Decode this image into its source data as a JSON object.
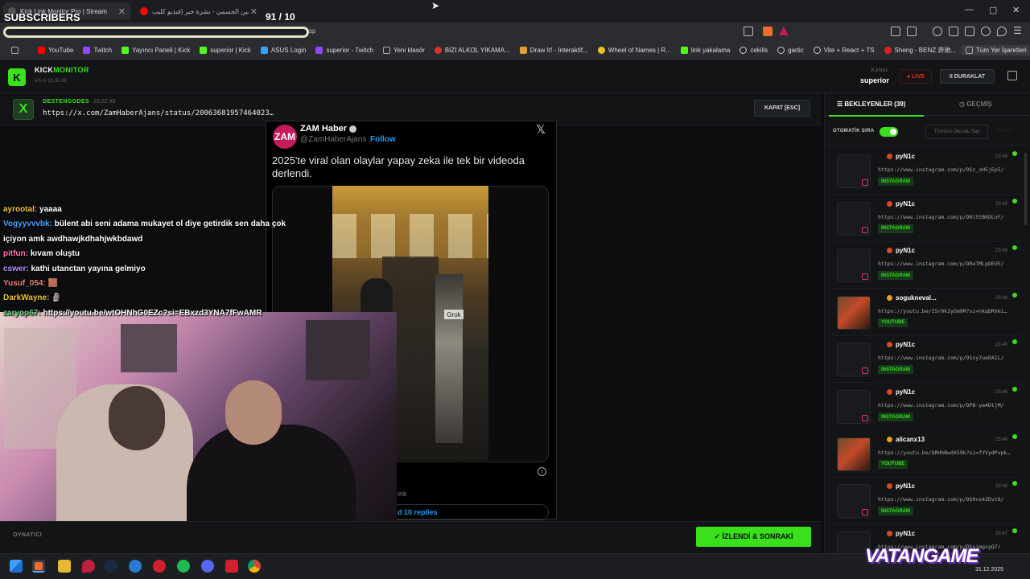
{
  "browser": {
    "tabs": [
      {
        "label": "Kick Link Monitor Pro | Stream",
        "active": true
      },
      {
        "label": "حسين الجسمي - بشرة خير (فيديو كليب...",
        "active": false
      }
    ],
    "overlay_subscribers": "SUBSCRIBERS",
    "overlay_counter": "91  / 10",
    "url_tail": "sp",
    "window_controls": [
      "—",
      "▢",
      "✕"
    ],
    "bookmarks": [
      {
        "label": "YouTube",
        "color": "#ff0000"
      },
      {
        "label": "Twitch",
        "color": "#9146ff"
      },
      {
        "label": "Yayıncı Paneli | Kick",
        "color": "#53fc18"
      },
      {
        "label": "superior | Kick",
        "color": "#53fc18"
      },
      {
        "label": "ASUS Login",
        "color": "#3aa0ff"
      },
      {
        "label": "superior - Twitch",
        "color": "#9146ff"
      },
      {
        "label": "Yeni klasör",
        "color": "#999999"
      },
      {
        "label": "BIZI ALKOL YIKAMA...",
        "color": "#d8332a"
      },
      {
        "label": "Draw It! - İnteraktif...",
        "color": "#e0a030"
      },
      {
        "label": "Wheel of Names | R...",
        "color": "#f0c020"
      },
      {
        "label": "link yakalama",
        "color": "#53fc18"
      },
      {
        "label": "cekilis",
        "color": "#cccccc"
      },
      {
        "label": "gartic",
        "color": "#cccccc"
      },
      {
        "label": "Vite + React + TS",
        "color": "#cccccc"
      },
      {
        "label": "Sheng - BENZ 奔驰...",
        "color": "#e02020"
      },
      {
        "label": "Tüm Yer İşaretleri",
        "color": "#999999"
      }
    ]
  },
  "app": {
    "logo_letter": "K",
    "brand_part1": "KICK",
    "brand_part2": "MONITOR",
    "version": "V3.0 QUEUE",
    "kanal_label": "KANAL",
    "kanal_value": "superior",
    "live_label": "● LIVE",
    "duraklat_label": "II  DURAKLAT",
    "current": {
      "source_icon": "X",
      "sender": "DESTENGODES",
      "time": "23:22:43",
      "url": "https://x.com/ZamHaberAjans/status/20063681957464023…",
      "close_label": "KAPAT [ESC]"
    },
    "tweet": {
      "avatar_text": "ZAM",
      "name": "ZAM Haber",
      "handle": "@ZamHaberAjans",
      "follow": "Follow",
      "text": "2025'te viral olan olaylar yapay zeka ile tek bir videoda derlendi.",
      "badge": "Grok",
      "copy_link": "ink",
      "replies": "d 10 replies"
    },
    "chat": [
      {
        "user": "ayrootal:",
        "msg": " yaaaa",
        "color": "#f0c030"
      },
      {
        "user": "Vogyyvvvbk:",
        "msg": " bülent abi seni adama mukayet ol diye getirdik sen daha çok içiyon amk awdhawjkdhahjwkbdawd",
        "color": "#4aa0ff"
      },
      {
        "user": "pitfun:",
        "msg": " kıvam oluştu",
        "color": "#ff7ab0"
      },
      {
        "user": "cswer:",
        "msg": " kathi utanctan yayına gelmiyo",
        "color": "#c090ff"
      },
      {
        "user": "Yusuf_054:",
        "msg": " 🟫",
        "color": "#f08080"
      },
      {
        "user": "DarkWayne:",
        "msg": " 🗿",
        "color": "#f0c030"
      },
      {
        "user": "zaryop67:",
        "msg": " https://youtu.be/wtOHNhG0EZc?si=EBxzd3YNA7fFwAMR",
        "color": "#6ad080"
      }
    ],
    "player_label": "OYNATICI",
    "izlendi_label": "✓  İZLENDİ & SONRAKİ",
    "panel": {
      "tab_waiting": "☰  BEKLEYENLER (39)",
      "tab_history": "◷  GEÇMİŞ",
      "auto_queue": "OTOMATİK SIRA",
      "mark_all": "Tümünü Okundu Say",
      "clear": "Temizle"
    },
    "queue": [
      {
        "user": "pyN1c",
        "time": "23:49",
        "url": "https://www.instagram.com/p/DSz_oH5jEp5/",
        "tag": "INSTAGRAM",
        "thumb": "ig"
      },
      {
        "user": "pyN1c",
        "time": "23:49",
        "url": "https://www.instagram.com/p/DRt5tB6DLnF/",
        "tag": "INSTAGRAM",
        "thumb": "ig"
      },
      {
        "user": "pyN1c",
        "time": "23:49",
        "url": "https://www.instagram.com/p/DReTMLpDEVE/",
        "tag": "INSTAGRAM",
        "thumb": "ig"
      },
      {
        "user": "sogukneval...",
        "time": "23:48",
        "url": "https://youtu.be/ISr0k2yGm9M?si=nkqDRVm1…",
        "tag": "YOUTUBE",
        "thumb": "img"
      },
      {
        "user": "pyN1c",
        "time": "23:48",
        "url": "https://www.instagram.com/p/DSxy7ueDAIL/",
        "tag": "INSTAGRAM",
        "thumb": "ig"
      },
      {
        "user": "pyN1c",
        "time": "23:48",
        "url": "https://www.instagram.com/p/DPB-ya4DtjM/",
        "tag": "INSTAGRAM",
        "thumb": "ig"
      },
      {
        "user": "alicanx13",
        "time": "23:48",
        "url": "https://youtu.be/QRHhBwdX59k?si=fYVydPvpk…",
        "tag": "YOUTUBE",
        "thumb": "img"
      },
      {
        "user": "pyN1c",
        "time": "23:48",
        "url": "https://www.instagram.com/p/DS0ce4ZDvt8/",
        "tag": "INSTAGRAM",
        "thumb": "ig"
      },
      {
        "user": "pyN1c",
        "time": "23:47",
        "url": "https://www.instagram.com/p/DSsimgsgQ7/",
        "tag": "INSTAGRAM",
        "thumb": "ig"
      }
    ]
  },
  "watermark": "VATANGAME",
  "clock": "31.12.2025",
  "colors": {
    "accent": "#39e01b",
    "live": "#e0352b",
    "twitter_blue": "#1d9bf0"
  }
}
